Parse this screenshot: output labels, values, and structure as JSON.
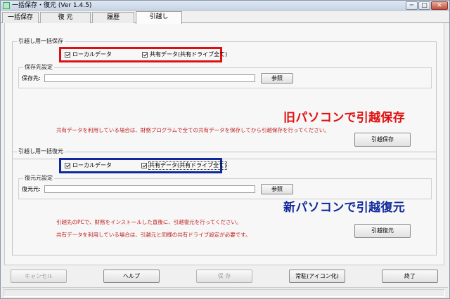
{
  "window": {
    "title": "一括保存・復元 (Ver 1.4.5)",
    "controls": {
      "minimize": "─",
      "maximize": "□",
      "close": "✕"
    }
  },
  "tabs": [
    {
      "label": "一括保存"
    },
    {
      "label": "復 元"
    },
    {
      "label": "履歴"
    },
    {
      "label": "引越し"
    }
  ],
  "save_group": {
    "title": "引越し用一括保存",
    "local_data": {
      "label": "ローカルデータ",
      "checked": true
    },
    "shared_data": {
      "label": "共有データ(共有ドライブ全て)",
      "checked": true
    },
    "dest_group_title": "保存先設定",
    "dest_label": "保存先:",
    "dest_value": "",
    "browse_label": "参照",
    "overlay_caption": "旧パソコンで引越保存",
    "note": "共有データを利用している場合は、財務プログラムで全ての共有データを保存してから引越保存を行ってください。",
    "action_label": "引越保存"
  },
  "restore_group": {
    "title": "引越し用一括復元",
    "local_data": {
      "label": "ローカルデータ",
      "checked": true
    },
    "shared_data": {
      "label": "共有データ(共有ドライブ全て)",
      "checked": true
    },
    "src_group_title": "復元元設定",
    "src_label": "復元元:",
    "src_value": "",
    "browse_label": "参照",
    "overlay_caption": "新パソコンで引越復元",
    "note_1": "引越先のPCで、財務をインストールした直後に、引越復元を行ってください。",
    "note_2": "共有データを利用している場合は、引越元と同様の共有ドライブ設定が必要です。",
    "action_label": "引越復元"
  },
  "footer": {
    "cancel_label": "キャンセル",
    "help_label": "ヘルプ",
    "save_label": "保 存",
    "tray_label": "常駐(アイコン化)",
    "exit_label": "終了"
  },
  "colors": {
    "highlight_red": "#e01010",
    "highlight_blue": "#102a9c"
  }
}
